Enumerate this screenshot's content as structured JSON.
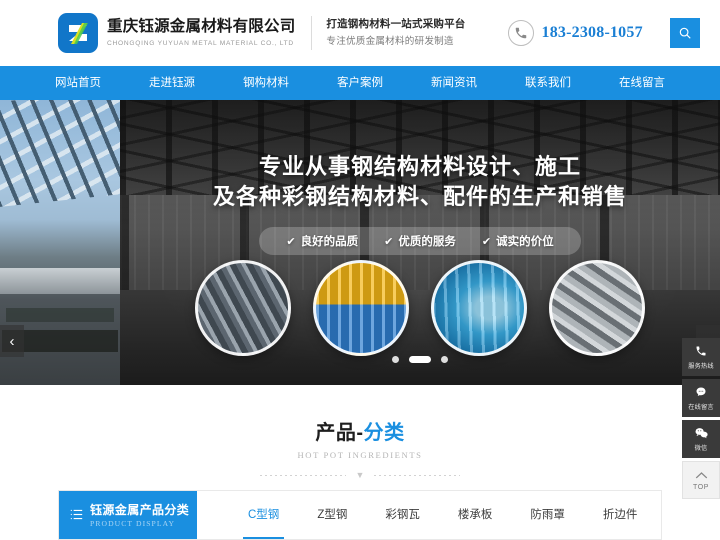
{
  "header": {
    "logo": {
      "icon": "company-logo-z-mark",
      "company_cn": "重庆钰源金属材料有限公司",
      "company_en": "CHONGQING YUYUAN METAL MATERIAL CO., LTD"
    },
    "slogan_line1": "打造钢构材料一站式采购平台",
    "slogan_line2": "专注优质金属材料的研发制造",
    "phone_icon": "phone-icon",
    "phone": "183-2308-1057",
    "search_icon": "search-icon"
  },
  "nav": {
    "items": [
      {
        "label": "网站首页"
      },
      {
        "label": "走进钰源"
      },
      {
        "label": "钢构材料"
      },
      {
        "label": "客户案例"
      },
      {
        "label": "新闻资讯"
      },
      {
        "label": "联系我们"
      },
      {
        "label": "在线留言"
      }
    ]
  },
  "banner": {
    "headline_line1": "专业从事钢结构材料设计、施工",
    "headline_line2": "及各种彩钢结构材料、配件的生产和销售",
    "check_glyph": "✔",
    "badges": [
      {
        "label": "良好的品质"
      },
      {
        "label": "优质的服务"
      },
      {
        "label": "诚实的价位"
      }
    ],
    "thumbs": [
      {
        "alt": "c-section-steel-bundle"
      },
      {
        "alt": "yellow-blue-color-steel-tile"
      },
      {
        "alt": "blue-arched-roof-panel"
      },
      {
        "alt": "galvanized-steel-decking"
      }
    ],
    "prev_arrow": "‹",
    "next_arrow": "›",
    "dots": [
      {
        "active": false
      },
      {
        "active": true
      },
      {
        "active": false
      }
    ]
  },
  "floatbar": {
    "items": [
      {
        "icon": "phone-icon",
        "glyph": "✆",
        "label": "服务热线"
      },
      {
        "icon": "chat-bubble-icon",
        "glyph": "💬",
        "label": "在线留言"
      },
      {
        "icon": "wechat-icon",
        "glyph": "🗨",
        "label": "微信"
      },
      {
        "icon": "arrow-up-icon",
        "glyph": "︿",
        "label": "TOP"
      }
    ]
  },
  "section": {
    "title_dark": "产品-",
    "title_accent": "分类",
    "subtitle": "HOT POT INGREDIENTS",
    "caret": "▼"
  },
  "product_bar": {
    "menu_icon": "list-menu-icon",
    "label_cn": "钰源金属产品分类",
    "label_en": "PRODUCT DISPLAY",
    "tabs": [
      {
        "label": "C型钢",
        "active": true
      },
      {
        "label": "Z型钢",
        "active": false
      },
      {
        "label": "彩钢瓦",
        "active": false
      },
      {
        "label": "楼承板",
        "active": false
      },
      {
        "label": "防雨罩",
        "active": false
      },
      {
        "label": "折边件",
        "active": false
      }
    ]
  },
  "colors": {
    "brand_blue": "#1a8fe0",
    "logo_blue": "#1176c9",
    "phone_blue": "#1a7fd4",
    "dark_text": "#1e1e1e",
    "floatbar_dark": "#3a3a3a"
  }
}
